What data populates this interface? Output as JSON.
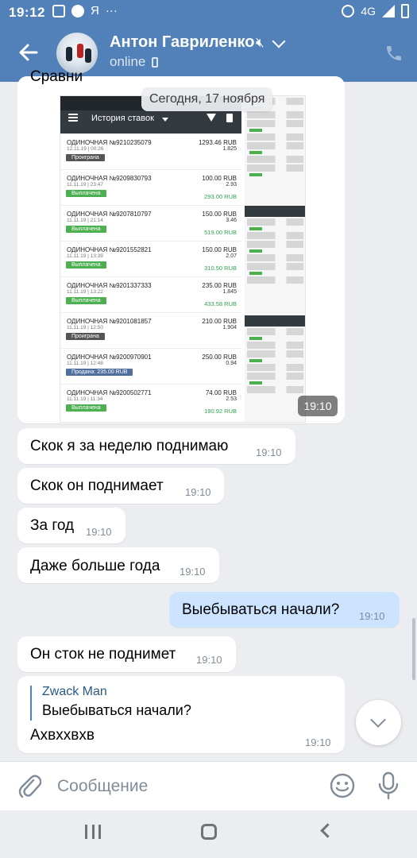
{
  "status_bar": {
    "time": "19:12",
    "carrier_glyph": "Я",
    "more": "···",
    "network": "4G"
  },
  "header": {
    "contact_name": "Антон Гавриленко",
    "presence": "online",
    "icons": [
      "back-arrow-icon",
      "muted-icon",
      "chevron-down-icon",
      "phone-icon"
    ]
  },
  "chat": {
    "cut_text": "Сравни",
    "date_divider": "Сегодня, 17 ноября",
    "photo_time": "19:10",
    "screenshot": {
      "toolbar_title": "История ставок",
      "bets": [
        {
          "title": "ОДИНОЧНАЯ №9210235079",
          "date": "12.11.19 | 00:26",
          "status": "Проиграна",
          "status_color": "#555555",
          "amount": "1293.46 RUB",
          "coef": "1.825",
          "win": ""
        },
        {
          "title": "ОДИНОЧНАЯ №9209830793",
          "date": "11.11.19 | 23:47",
          "status": "Выплачена",
          "status_color": "#4caf50",
          "amount": "100.00 RUB",
          "coef": "2.93",
          "win": "293.00 RUB"
        },
        {
          "title": "ОДИНОЧНАЯ №9207810797",
          "date": "11.11.19 | 21:14",
          "status": "Выплачена",
          "status_color": "#4caf50",
          "amount": "150.00 RUB",
          "coef": "3.46",
          "win": "519.00 RUB"
        },
        {
          "title": "ОДИНОЧНАЯ №9201552821",
          "date": "11.11.19 | 13:39",
          "status": "Выплачена",
          "status_color": "#4caf50",
          "amount": "150.00 RUB",
          "coef": "2.07",
          "win": "310.50 RUB"
        },
        {
          "title": "ОДИНОЧНАЯ №9201337333",
          "date": "11.11.19 | 13:22",
          "status": "Выплачена",
          "status_color": "#4caf50",
          "amount": "235.00 RUB",
          "coef": "1.845",
          "win": "433.58 RUB"
        },
        {
          "title": "ОДИНОЧНАЯ №9201081857",
          "date": "11.11.19 | 12:50",
          "status": "Проиграна",
          "status_color": "#555555",
          "amount": "210.00 RUB",
          "coef": "1.904",
          "win": ""
        },
        {
          "title": "ОДИНОЧНАЯ №9200970901",
          "date": "11.11.19 | 12:48",
          "status": "Продана: 235.00 RUB",
          "status_color": "#4f6f9f",
          "amount": "250.00 RUB",
          "coef": "0.94",
          "win": ""
        },
        {
          "title": "ОДИНОЧНАЯ №9200502771",
          "date": "11.11.19 | 11:34",
          "status": "Выплачена",
          "status_color": "#4caf50",
          "amount": "74.00 RUB",
          "coef": "2.53",
          "win": "190.92 RUB"
        }
      ]
    },
    "messages": [
      {
        "dir": "in",
        "text": "Скок я за неделю поднимаю",
        "time": "19:10"
      },
      {
        "dir": "in",
        "text": "Скок он поднимает",
        "time": "19:10"
      },
      {
        "dir": "in",
        "text": "За год",
        "time": "19:10"
      },
      {
        "dir": "in",
        "text": "Даже больше года",
        "time": "19:10"
      },
      {
        "dir": "out",
        "text": "Выебываться начали?",
        "time": "19:10"
      },
      {
        "dir": "in",
        "text": "Он сток не поднимет",
        "time": "19:10"
      }
    ],
    "reply_message": {
      "author": "Zwack Man",
      "quote": "Выебываться начали?",
      "text": "Ахвххвхв",
      "time": "19:10"
    }
  },
  "composer": {
    "placeholder": "Сообщение",
    "icons": [
      "attach-icon",
      "emoji-icon",
      "microphone-icon"
    ]
  },
  "system_nav": {
    "icons": [
      "recent-apps-icon",
      "home-icon",
      "back-icon"
    ]
  }
}
